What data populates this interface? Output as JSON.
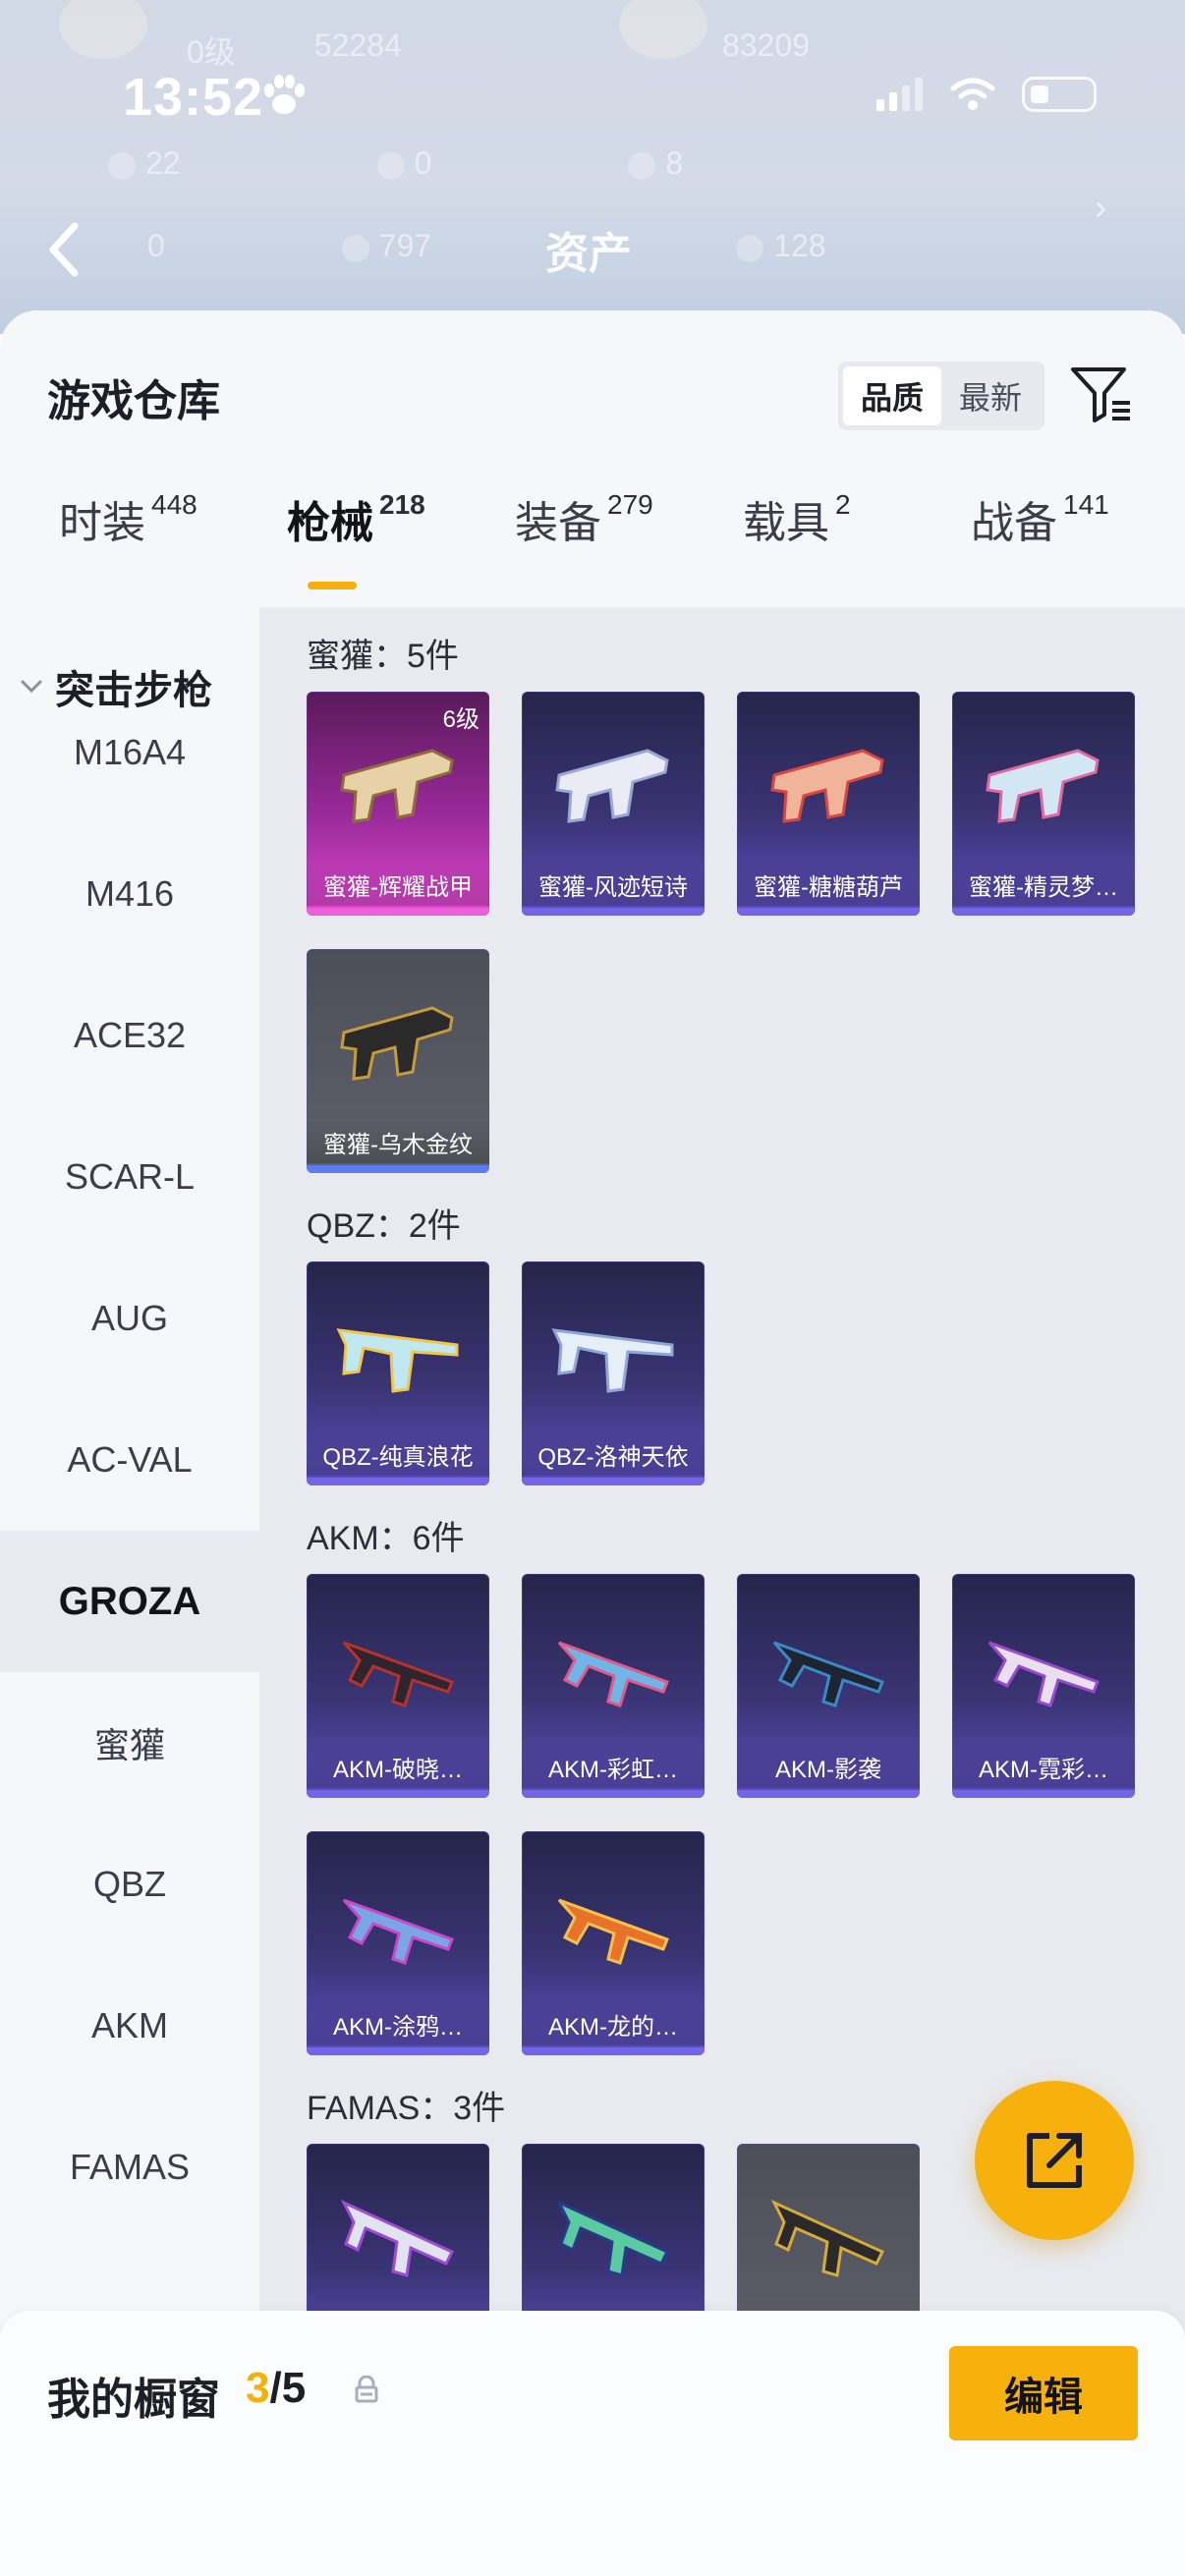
{
  "status_bar": {
    "time": "13:52"
  },
  "background": {
    "title": "资产",
    "faded_stats": [
      "0级",
      "52284",
      "83209",
      "22",
      "0",
      "8",
      "0",
      "797",
      "128"
    ]
  },
  "sheet": {
    "title": "游戏仓库",
    "sort": {
      "quality": "品质",
      "newest": "最新"
    }
  },
  "tabs": [
    {
      "label": "时装",
      "count": "448"
    },
    {
      "label": "枪械",
      "count": "218"
    },
    {
      "label": "装备",
      "count": "279"
    },
    {
      "label": "载具",
      "count": "2"
    },
    {
      "label": "战备",
      "count": "141"
    }
  ],
  "sidebar": {
    "group": "突击步枪",
    "items": [
      "M16A4",
      "M416",
      "ACE32",
      "SCAR-L",
      "AUG",
      "AC-VAL",
      "GROZA",
      "蜜獾",
      "QBZ",
      "AKM",
      "FAMAS"
    ]
  },
  "sections": [
    {
      "title": "蜜獾：5件",
      "items": [
        {
          "label": "蜜獾-辉耀战甲",
          "level": "6级",
          "style": "pink"
        },
        {
          "label": "蜜獾-风迹短诗",
          "style": "purple"
        },
        {
          "label": "蜜獾-糖糖葫芦",
          "style": "purple"
        },
        {
          "label": "蜜獾-精灵梦…",
          "style": "purple"
        },
        {
          "label": "蜜獾-乌木金纹",
          "style": "grey"
        }
      ]
    },
    {
      "title": "QBZ：2件",
      "items": [
        {
          "label": "QBZ-纯真浪花",
          "style": "purple"
        },
        {
          "label": "QBZ-洛神天依",
          "style": "purple"
        }
      ]
    },
    {
      "title": "AKM：6件",
      "items": [
        {
          "label": "AKM-破晓…",
          "style": "purple"
        },
        {
          "label": "AKM-彩虹…",
          "style": "purple"
        },
        {
          "label": "AKM-影袭",
          "style": "purple"
        },
        {
          "label": "AKM-霓彩…",
          "style": "purple"
        },
        {
          "label": "AKM-涂鸦…",
          "style": "purple"
        },
        {
          "label": "AKM-龙的…",
          "style": "purple"
        }
      ]
    },
    {
      "title": "FAMAS：3件",
      "items": [
        {
          "label": "",
          "style": "purple"
        },
        {
          "label": "",
          "style": "purple"
        },
        {
          "label": "",
          "style": "grey"
        }
      ]
    }
  ],
  "bottom_bar": {
    "label": "我的橱窗",
    "current": "3",
    "total": "/5",
    "edit": "编辑"
  },
  "colors": {
    "accent": "#f7b10d",
    "card_purple": "#3a3474",
    "card_pink": "#9a2a9a",
    "card_grey": "#5e6169"
  },
  "icons": [
    "back-arrow-icon",
    "paw-icon",
    "signal-icon",
    "wifi-icon",
    "battery-icon",
    "filter-icon",
    "chevron-down-icon",
    "share-icon",
    "lock-icon",
    "gun-icon"
  ]
}
